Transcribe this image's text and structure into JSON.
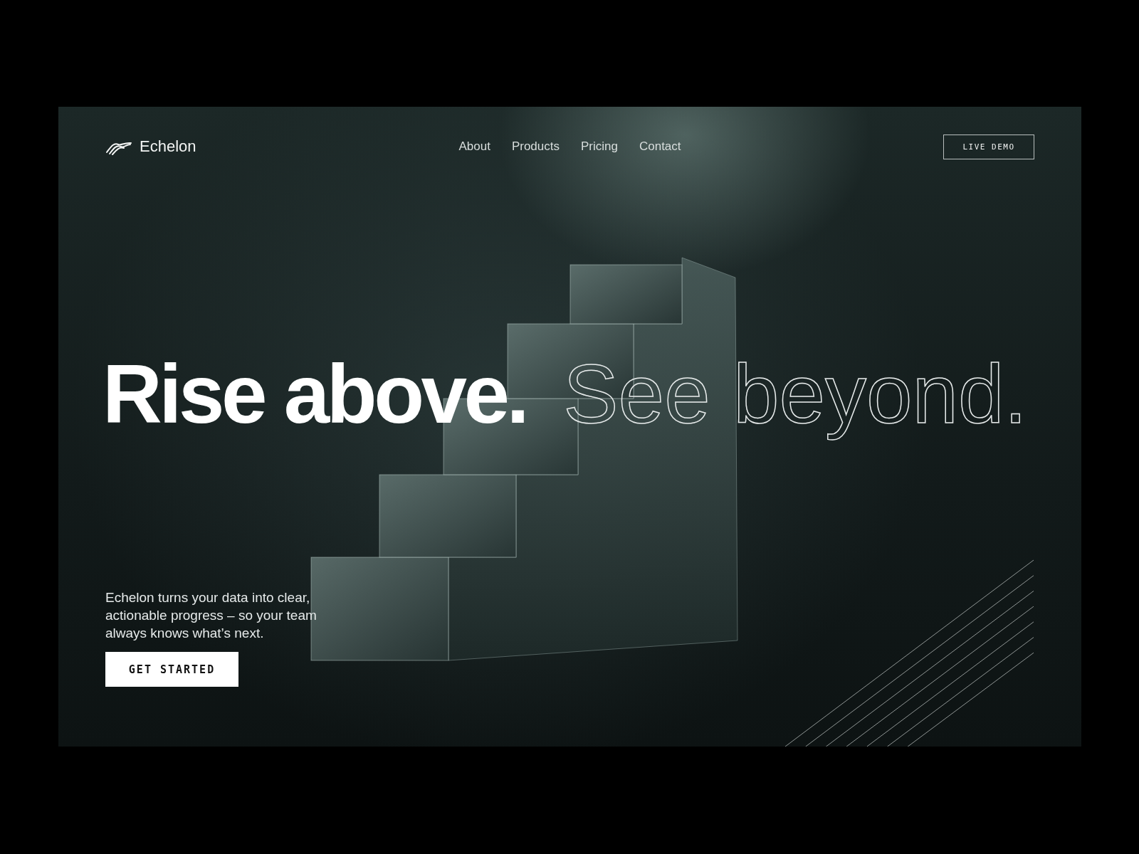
{
  "brand": {
    "name": "Echelon"
  },
  "nav": [
    {
      "label": "About"
    },
    {
      "label": "Products"
    },
    {
      "label": "Pricing"
    },
    {
      "label": "Contact"
    }
  ],
  "header_button": {
    "label": "LIVE DEMO"
  },
  "headline": [
    {
      "text": "Rise above.",
      "kind": "solid"
    },
    {
      "text": "See beyond.",
      "kind": "outline"
    }
  ],
  "description": "Echelon turns your data into clear, actionable progress – so your team always knows what’s next.",
  "cta": {
    "label": "GET STARTED"
  }
}
